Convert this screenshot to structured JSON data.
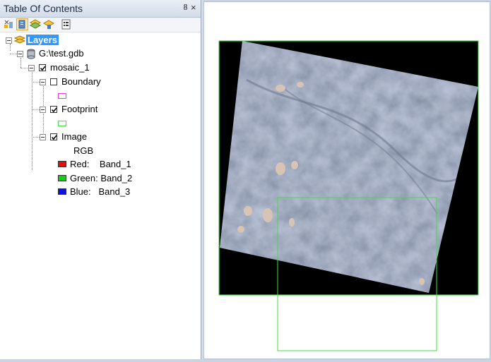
{
  "toc": {
    "title": "Table Of Contents",
    "pin_glyph": "ᵠ",
    "close_glyph": "×",
    "toolbar": [
      "list-by-drawing-order-icon",
      "list-by-source-icon",
      "list-by-visibility-icon",
      "list-by-selection-icon",
      "options-icon"
    ],
    "layers_label": "Layers",
    "gdb_label": "G:\\test.gdb",
    "mosaic_label": "mosaic_1",
    "boundary": {
      "label": "Boundary",
      "checked": false,
      "color": "#e040e0"
    },
    "footprint": {
      "label": "Footprint",
      "checked": true,
      "color": "#40e040"
    },
    "image": {
      "label": "Image",
      "checked": true,
      "rgb_label": "RGB",
      "bands": [
        {
          "label": "Red:    Band_1",
          "color": "#e01010"
        },
        {
          "label": "Green: Band_2",
          "color": "#10d010"
        },
        {
          "label": "Blue:   Band_3",
          "color": "#1010e0"
        }
      ]
    }
  },
  "map": {
    "footprint_color": "#3ee03e"
  }
}
